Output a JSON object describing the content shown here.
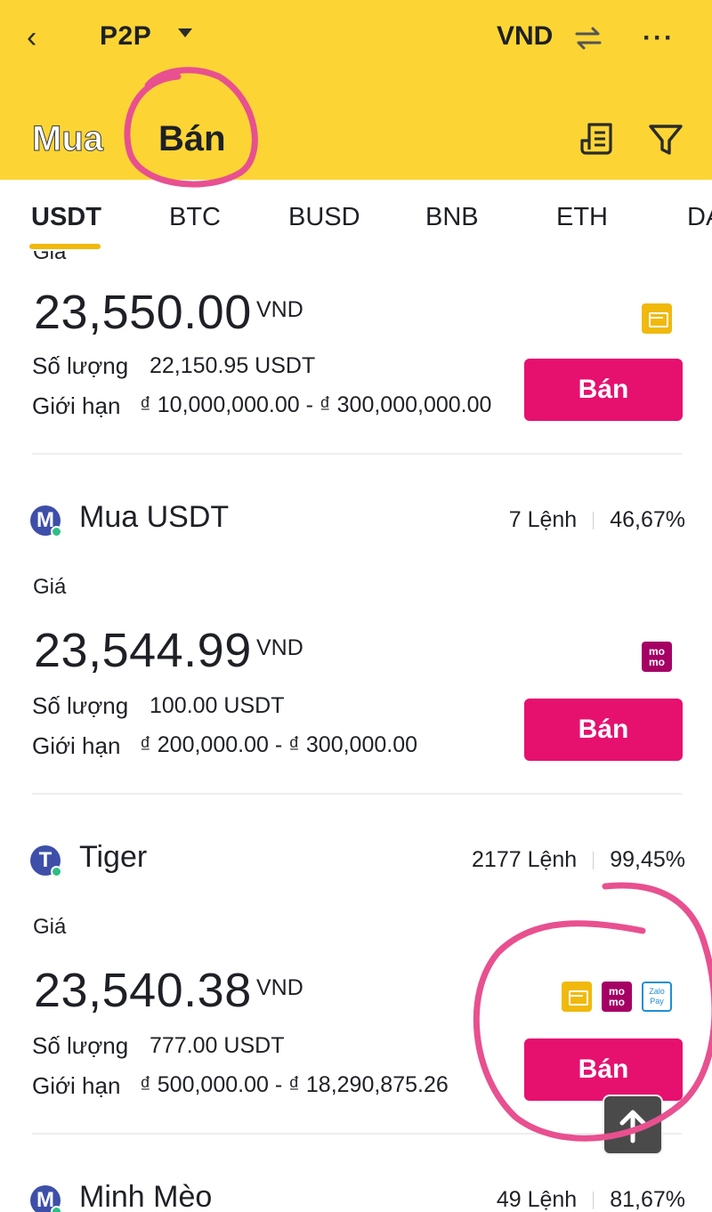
{
  "header": {
    "back_glyph": "‹",
    "title": "P2P",
    "currency": "VND",
    "more_glyph": "···"
  },
  "side_tabs": [
    "Mua",
    "Bán"
  ],
  "coins": [
    "USDT",
    "BTC",
    "BUSD",
    "BNB",
    "ETH",
    "DA"
  ],
  "labels": {
    "price": "Giá",
    "amount": "Số lượng",
    "limit": "Giới hạn",
    "sell": "Bán",
    "unit": "VND"
  },
  "ads": [
    {
      "advertiser": "",
      "price": "23,550.00",
      "amount": "22,150.95 USDT",
      "limit": "₫ 10,000,000.00 - ₫ 300,000,000.00",
      "payments": [
        "bank-transfer"
      ]
    },
    {
      "avatar_letter": "M",
      "advertiser": "Mua USDT",
      "orders": "7 Lệnh",
      "completion": "46,67%",
      "price": "23,544.99",
      "amount": "100.00 USDT",
      "limit": "₫ 200,000.00 - ₫ 300,000.00",
      "payments": [
        "momo"
      ]
    },
    {
      "avatar_letter": "T",
      "advertiser": "Tiger",
      "orders": "2177 Lệnh",
      "completion": "99,45%",
      "price": "23,540.38",
      "amount": "777.00 USDT",
      "limit": "₫ 500,000.00 - ₫ 18,290,875.26",
      "payments": [
        "bank-transfer",
        "momo",
        "zalopay"
      ]
    },
    {
      "avatar_letter": "M",
      "advertiser": "Minh Mèo",
      "orders": "49 Lệnh",
      "completion": "81,67%"
    }
  ],
  "payment_icons": {
    "momo_text": "mo mo",
    "zalo_text": "Zalo Pay"
  },
  "colors": {
    "header_bg": "#fcd535",
    "sell_button": "#e6106f",
    "accent": "#f0b90b",
    "annotation": "#e8508f"
  }
}
